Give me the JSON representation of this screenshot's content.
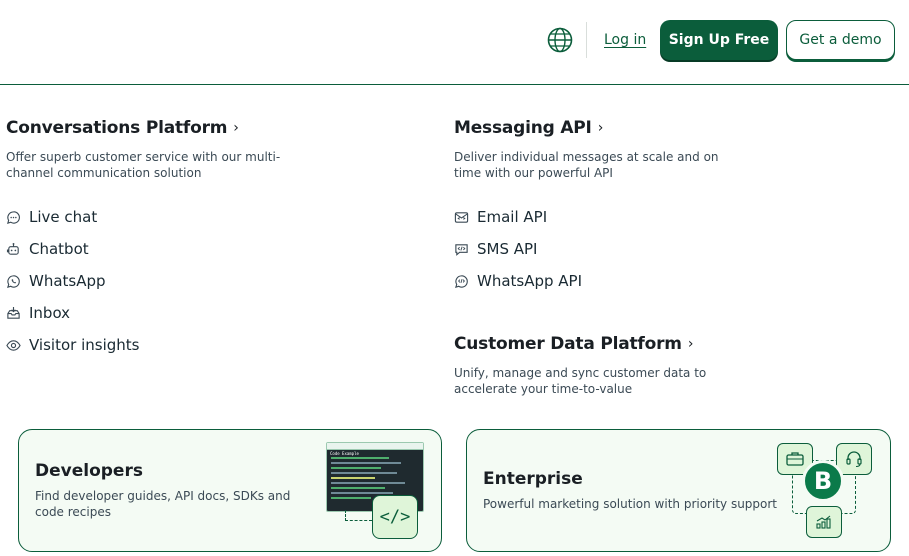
{
  "header": {
    "login_label": "Log in",
    "signup_label": "Sign Up Free",
    "demo_label": "Get a demo",
    "globe_icon": "globe-icon"
  },
  "conversations": {
    "title": "Conversations Platform",
    "description": "Offer superb customer service with our multi-channel communication solution",
    "items": [
      {
        "label": "Live chat",
        "icon": "chat-bubble-icon"
      },
      {
        "label": "Chatbot",
        "icon": "chatbot-icon"
      },
      {
        "label": "WhatsApp",
        "icon": "whatsapp-icon"
      },
      {
        "label": "Inbox",
        "icon": "inbox-icon"
      },
      {
        "label": "Visitor insights",
        "icon": "eye-icon"
      }
    ]
  },
  "messaging": {
    "title": "Messaging API",
    "description": "Deliver individual messages at scale and on time with our powerful API",
    "items": [
      {
        "label": "Email API",
        "icon": "email-api-icon"
      },
      {
        "label": "SMS API",
        "icon": "sms-api-icon"
      },
      {
        "label": "WhatsApp API",
        "icon": "whatsapp-api-icon"
      }
    ]
  },
  "cdp": {
    "title": "Customer Data Platform",
    "description": "Unify, manage and sync customer data to accelerate your time-to-value"
  },
  "cards": {
    "developers": {
      "title": "Developers",
      "description": "Find developer guides, API docs, SDKs and code recipes",
      "code_window_title": "Code Example"
    },
    "enterprise": {
      "title": "Enterprise",
      "description": "Powerful marketing solution with priority support",
      "badge_letter": "B"
    }
  },
  "colors": {
    "brand_green": "#0b5d3b",
    "card_bg": "#f4fbf4",
    "tile_bg": "#dff5d9"
  }
}
